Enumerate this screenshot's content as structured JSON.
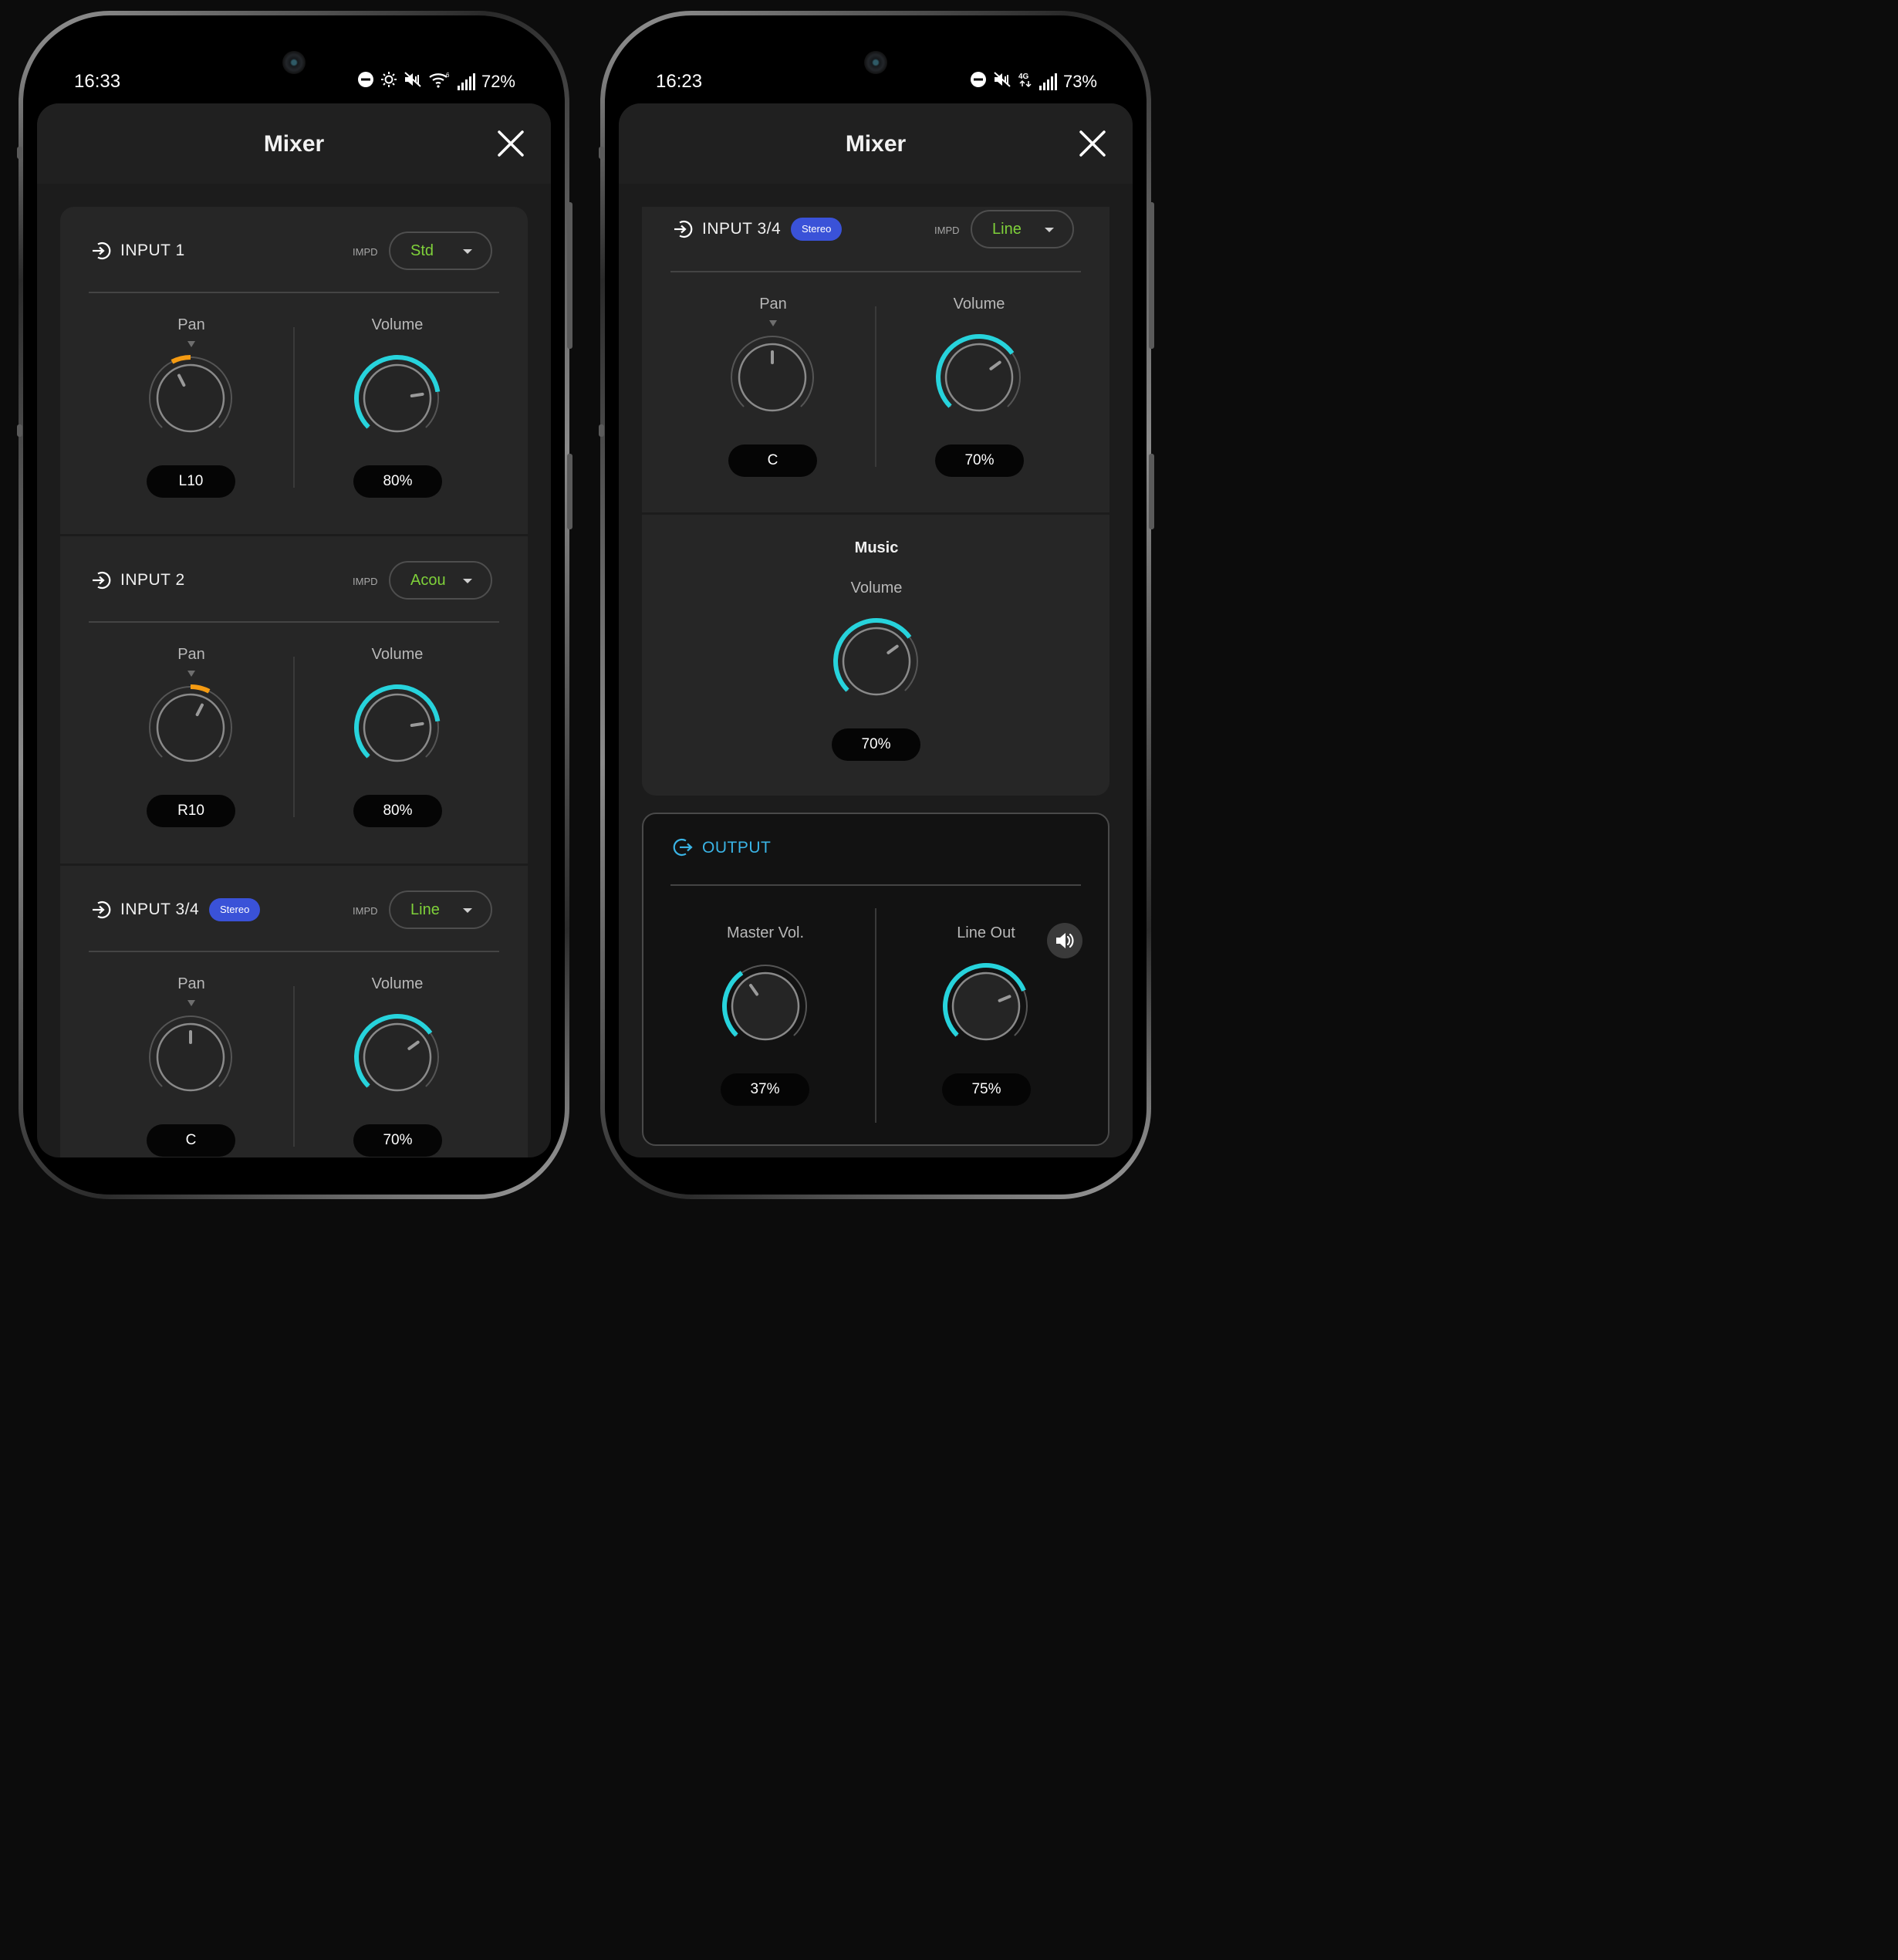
{
  "left_phone": {
    "status": {
      "time": "16:33",
      "battery": "72%",
      "icons": [
        "dnd-icon",
        "brightness-icon",
        "mute-icon",
        "wifi-6-icon",
        "signal-icon"
      ]
    },
    "title": "Mixer",
    "channels": [
      {
        "name": "INPUT 1",
        "impd_label": "IMPD",
        "impd_value": "Std",
        "pan_label": "Pan",
        "pan_value": "L10",
        "volume_label": "Volume",
        "volume_value": "80%"
      },
      {
        "name": "INPUT 2",
        "impd_label": "IMPD",
        "impd_value": "Acou",
        "pan_label": "Pan",
        "pan_value": "R10",
        "volume_label": "Volume",
        "volume_value": "80%"
      },
      {
        "name": "INPUT 3/4",
        "badge": "Stereo",
        "impd_label": "IMPD",
        "impd_value": "Line",
        "pan_label": "Pan",
        "pan_value": "C",
        "volume_label": "Volume",
        "volume_value": "70%"
      }
    ]
  },
  "right_phone": {
    "status": {
      "time": "16:23",
      "battery": "73%",
      "icons": [
        "dnd-icon",
        "mute-icon",
        "4g-icon",
        "signal-icon"
      ]
    },
    "title": "Mixer",
    "channel": {
      "name": "INPUT 3/4",
      "badge": "Stereo",
      "impd_label": "IMPD",
      "impd_value": "Line",
      "pan_label": "Pan",
      "pan_value": "C",
      "volume_label": "Volume",
      "volume_value": "70%"
    },
    "music": {
      "title": "Music",
      "volume_label": "Volume",
      "volume_value": "70%"
    },
    "output": {
      "name": "OUTPUT",
      "master_label": "Master Vol.",
      "master_value": "37%",
      "lineout_label": "Line Out",
      "lineout_value": "75%"
    }
  },
  "colors": {
    "accent_cyan": "#27d3dc",
    "pan_orange": "#f59b12",
    "impd_green": "#7fd13a",
    "stereo_blue": "#3a52d8",
    "output_blue": "#3ab4e6"
  },
  "knob_values": {
    "left_in1_pan": -10,
    "left_in1_vol": 80,
    "left_in2_pan": 10,
    "left_in2_vol": 80,
    "left_in3_pan": 0,
    "left_in3_vol": 70,
    "right_in3_pan": 0,
    "right_in3_vol": 70,
    "right_music_vol": 70,
    "right_master_vol": 37,
    "right_lineout_vol": 75
  }
}
